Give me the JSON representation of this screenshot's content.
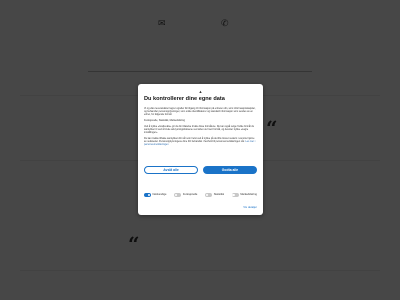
{
  "background": {
    "mail_icon": "✉",
    "phone_icon": "✆",
    "quote_glyph": "“"
  },
  "consent_dialog": {
    "logo_glyph": "▲",
    "title": "Du kontrollerer dine egne data",
    "paragraphs": [
      "Vi og våre leverandører lagrer og/eller får tilgang til informasjon på enheten din, som informasjonskapsler, og behandler personopplysninger, som unike identifikatorer og standard informasjon som sendes av en enhet, for følgende formål.",
      "Funksjonelle, Statistikk, Markedsføring",
      "Ved å trykke «Godta alle» gir du din tillatelse til alle disse formålene. Du kan også velge hvilke formål du samtykker til ved å bruke avkrysningsboksene ved siden av hvert formål, og deretter trykke «Lagre innstillinger».",
      "Du kan trekke tilbake samtykket ditt når som helst ved å trykke på det lille ikonet nederst i venstre hjørne av nettstedet. Personopplysningene dine blir behandlet i henhold til personvernerklæringen vår."
    ],
    "link_text": "Les mer i personvernerklæringen",
    "reject_label": "Avslå alle",
    "accept_label": "Godta alle",
    "toggles": [
      {
        "label": "Nødvendige",
        "on": true
      },
      {
        "label": "Funksjonelle",
        "on": false
      },
      {
        "label": "Statistikk",
        "on": false
      },
      {
        "label": "Markedsføring",
        "on": false
      }
    ],
    "settings_label": "Vis detaljer"
  }
}
